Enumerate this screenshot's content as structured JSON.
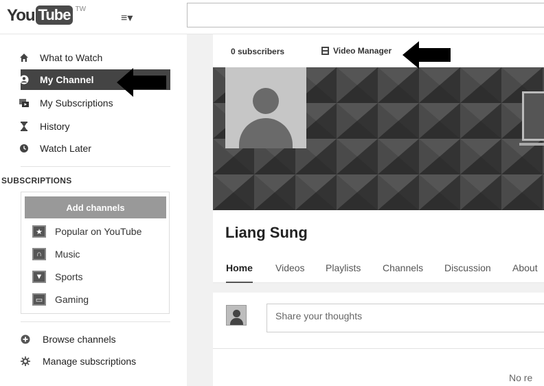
{
  "header": {
    "logo_you": "You",
    "logo_tube": "Tube",
    "logo_region": "TW",
    "guide_menu_icon": "hamburger-dropdown-icon",
    "search_placeholder": ""
  },
  "sidebar": {
    "nav": [
      {
        "label": "What to Watch",
        "icon": "home-icon"
      },
      {
        "label": "My Channel",
        "icon": "user-circle-icon",
        "active": true
      },
      {
        "label": "My Subscriptions",
        "icon": "subscriptions-icon"
      },
      {
        "label": "History",
        "icon": "hourglass-icon"
      },
      {
        "label": "Watch Later",
        "icon": "clock-icon"
      }
    ],
    "subscriptions_heading": "SUBSCRIPTIONS",
    "add_channels_label": "Add channels",
    "subscriptions": [
      {
        "label": "Popular on YouTube",
        "icon": "star-icon"
      },
      {
        "label": "Music",
        "icon": "headphones-icon"
      },
      {
        "label": "Sports",
        "icon": "trophy-icon"
      },
      {
        "label": "Gaming",
        "icon": "gamepad-icon"
      }
    ],
    "bottom": [
      {
        "label": "Browse channels",
        "icon": "plus-circle-icon"
      },
      {
        "label": "Manage subscriptions",
        "icon": "gear-icon"
      }
    ]
  },
  "channel": {
    "subscriber_count": "0 subscribers",
    "video_manager_label": "Video Manager",
    "name": "Liang Sung",
    "tabs": [
      "Home",
      "Videos",
      "Playlists",
      "Channels",
      "Discussion",
      "About"
    ],
    "active_tab": "Home",
    "share_placeholder": "Share your thoughts",
    "no_recent_text": "No re"
  },
  "annotations": {
    "arrow_color": "#000000"
  }
}
